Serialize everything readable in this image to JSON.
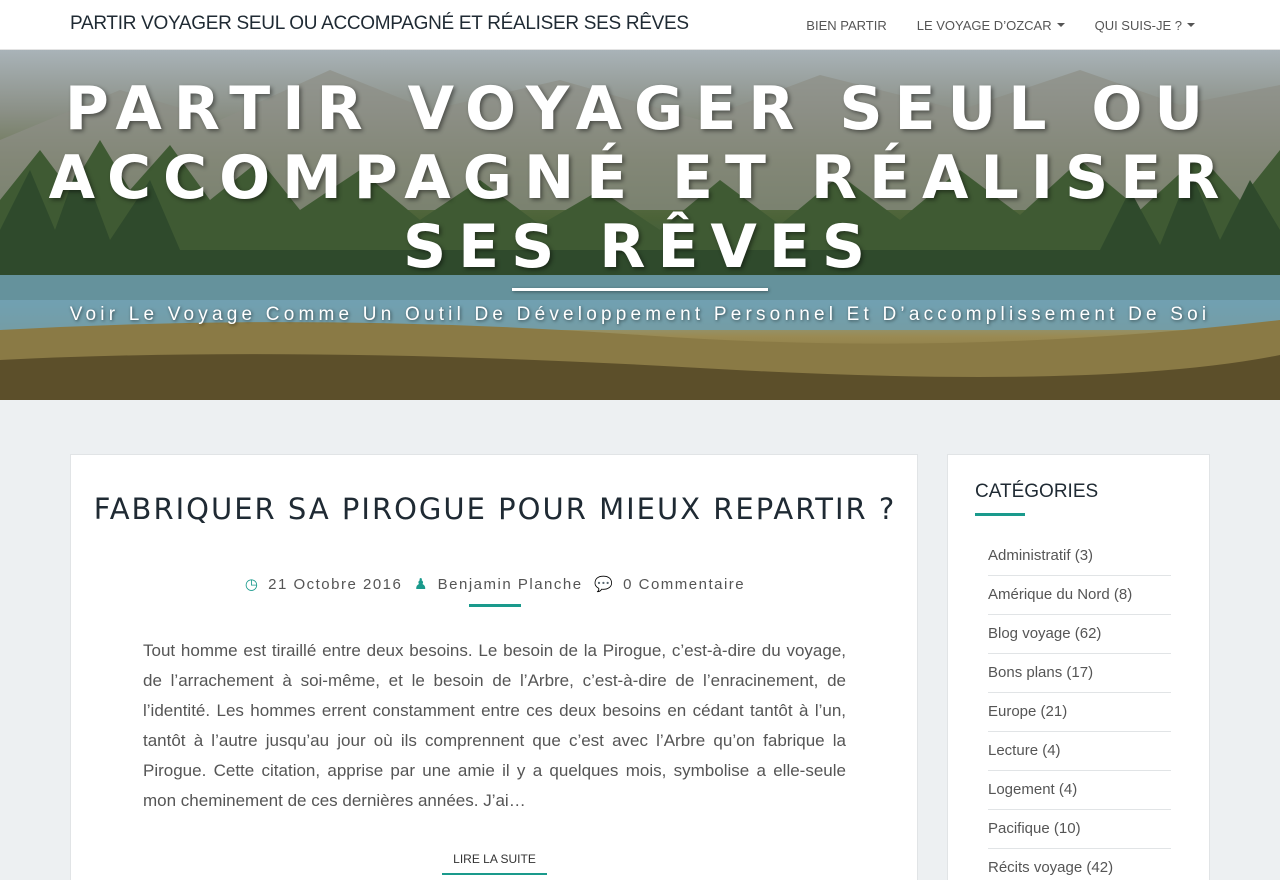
{
  "navbar": {
    "brand": "PARTIR VOYAGER SEUL OU ACCOMPAGNÉ ET RÉALISER SES RÊVES",
    "items": [
      {
        "label": "BIEN PARTIR",
        "dropdown": false
      },
      {
        "label": "LE VOYAGE D’OZCAR",
        "dropdown": true
      },
      {
        "label": "QUI SUIS-JE ?",
        "dropdown": true
      }
    ]
  },
  "hero": {
    "title": "PARTIR VOYAGER SEUL OU ACCOMPAGNÉ ET RÉALISER SES RÊVES",
    "subtitle": "Voir Le Voyage Comme Un Outil De Développement Personnel Et D’accomplissement De Soi"
  },
  "post": {
    "title": "FABRIQUER SA PIROGUE POUR MIEUX REPARTIR ?",
    "date": "21 Octobre 2016",
    "author": "Benjamin Planche",
    "comments": "0 Commentaire",
    "excerpt": "Tout homme est tiraillé entre deux besoins. Le besoin de la Pirogue, c’est-à-dire du voyage, de l’arrachement à soi-même, et le besoin de l’Arbre, c’est-à-dire de l’enracinement, de l’identité. Les hommes errent constamment entre ces deux besoins en cédant tantôt à l’un, tantôt à l’autre jusqu’au jour où ils comprennent que c’est avec l’Arbre qu’on fabrique la Pirogue.  Cette citation, apprise par une amie il y a quelques mois, symbolise a elle-seule mon cheminement de ces dernières années. J’ai…",
    "read_more": "LIRE LA SUITE"
  },
  "sidebar": {
    "title": "CATÉGORIES",
    "categories": [
      {
        "name": "Administratif",
        "count": "(3)"
      },
      {
        "name": "Amérique du Nord",
        "count": "(8)"
      },
      {
        "name": "Blog voyage",
        "count": "(62)"
      },
      {
        "name": "Bons plans",
        "count": "(17)"
      },
      {
        "name": "Europe",
        "count": "(21)"
      },
      {
        "name": "Lecture",
        "count": "(4)"
      },
      {
        "name": "Logement",
        "count": "(4)"
      },
      {
        "name": "Pacifique",
        "count": "(10)"
      },
      {
        "name": "Récits voyage",
        "count": "(42)"
      }
    ]
  },
  "colors": {
    "accent": "#1a9a8c",
    "background": "#edf0f2",
    "heading": "#1f2a33"
  },
  "icons": {
    "date": "clock-icon",
    "author": "user-icon",
    "comments": "comments-icon"
  }
}
